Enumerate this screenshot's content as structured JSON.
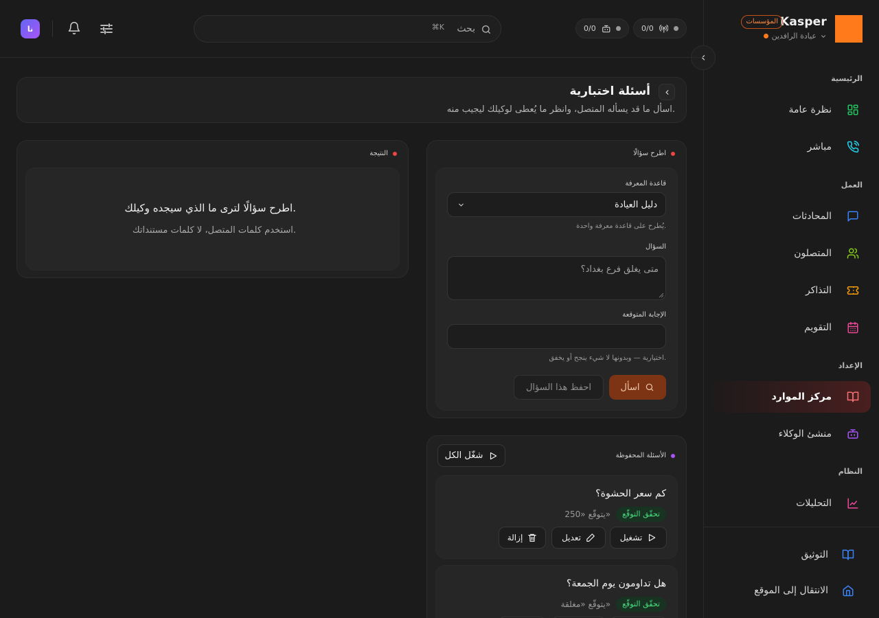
{
  "brand": {
    "name": "Kasper",
    "plan_badge": "المؤسسات",
    "org_name": "عيادة الرافدين",
    "logo_color": "#ff7a1a"
  },
  "topbar": {
    "stat_pills": [
      {
        "icon": "antenna-icon",
        "value": "0/0"
      },
      {
        "icon": "bot-icon",
        "value": "0/0"
      }
    ],
    "search": {
      "placeholder": "بحث",
      "shortcut": "⌘K"
    },
    "avatar_initials": "نا"
  },
  "sidebar": {
    "sections": [
      {
        "label": "الرئيسية",
        "items": [
          {
            "label": "نظرة عامة",
            "icon": "grid-icon"
          },
          {
            "label": "مباشر",
            "icon": "phone-live-icon"
          }
        ]
      },
      {
        "label": "العمل",
        "items": [
          {
            "label": "المحادثات",
            "icon": "message-icon"
          },
          {
            "label": "المتصلون",
            "icon": "users-icon"
          },
          {
            "label": "التذاكر",
            "icon": "ticket-icon"
          },
          {
            "label": "التقويم",
            "icon": "calendar-icon"
          }
        ]
      },
      {
        "label": "الإعداد",
        "items": [
          {
            "label": "مركز الموارد",
            "icon": "book-open-icon",
            "active": true
          },
          {
            "label": "منشئ الوكلاء",
            "icon": "bot-icon"
          }
        ]
      },
      {
        "label": "النظام",
        "items": [
          {
            "label": "التحليلات",
            "icon": "chart-line-icon"
          }
        ]
      }
    ],
    "footer": [
      {
        "label": "التوثيق",
        "icon": "book-icon"
      },
      {
        "label": "الانتقال إلى الموقع",
        "icon": "home-icon"
      }
    ]
  },
  "page": {
    "title": "أسئلة اختبارية",
    "subtitle": "اسأل ما قد يسأله المتصل، وانظر ما يُعطى لوكيلك ليجيب منه."
  },
  "ask_panel": {
    "heading": "اطرح سؤالًا",
    "kb_label": "قاعدة المعرفة",
    "kb_value": "دليل العيادة",
    "kb_hint": "يُطرح على قاعدة معرفة واحدة.",
    "question_label": "السؤال",
    "question_placeholder": "متى يغلق فرع بغداد؟",
    "expected_label": "الإجابة المتوقعة",
    "expected_value": "",
    "expected_hint": "اختيارية — وبدونها لا شيء ينجح أو يخفق.",
    "ask_button": "اسأل",
    "save_button": "احفظ هذا السؤال"
  },
  "result_panel": {
    "heading": "النتيجة",
    "empty_title": "اطرح سؤالًا لترى ما الذي سيجده وكيلك.",
    "empty_subtitle": "استخدم كلمات المتصل، لا كلمات مستنداتك."
  },
  "saved_panel": {
    "heading": "الأسئلة المحفوظة",
    "run_all": "شغّل الكل",
    "items": [
      {
        "question": "كم سعر الحشوة؟",
        "tag": "تحقّق التوقّع",
        "expect": "يتوقّع «250»"
      },
      {
        "question": "هل تداومون يوم الجمعة؟",
        "tag": "تحقّق التوقّع",
        "expect": "يتوقّع «مغلقة»"
      }
    ],
    "actions": {
      "run": "تشغيل",
      "edit": "تعديل",
      "remove": "إزالة"
    }
  },
  "colors": {
    "accent": "#ff7a1a",
    "ask_dot": "#ef4444",
    "saved_dot": "#a855f7",
    "success": "#4ade80"
  }
}
